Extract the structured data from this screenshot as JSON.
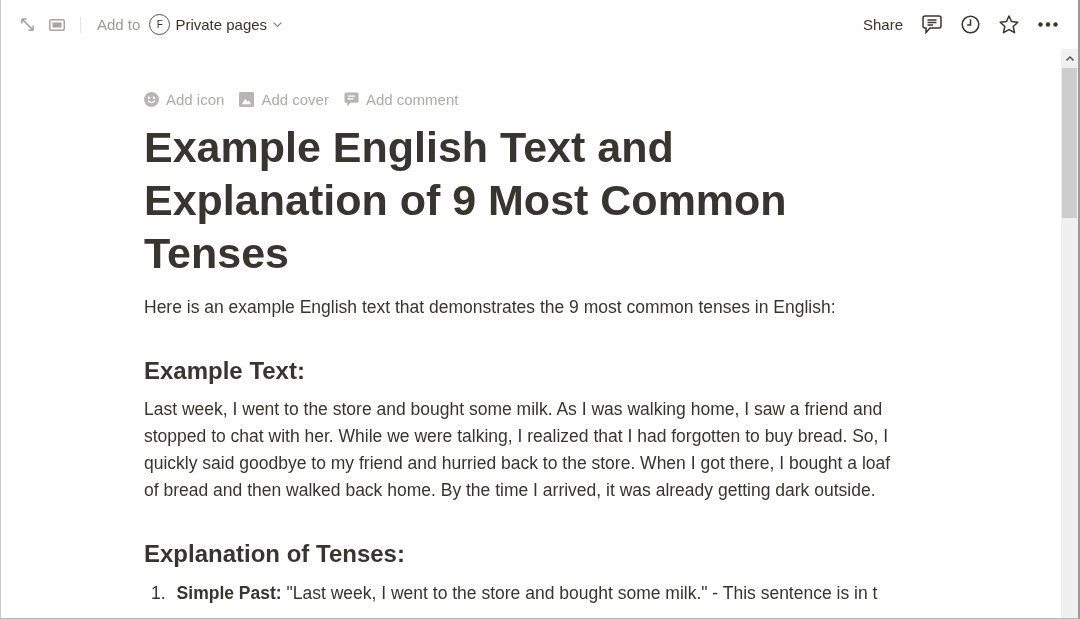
{
  "toolbar": {
    "add_to_label": "Add to",
    "workspace": {
      "initial": "F",
      "name": "Private pages"
    },
    "share_label": "Share"
  },
  "page_actions": [
    {
      "kind": "icon",
      "label": "Add icon"
    },
    {
      "kind": "cover",
      "label": "Add cover"
    },
    {
      "kind": "comment",
      "label": "Add comment"
    }
  ],
  "title": "Example English Text and Explanation of 9 Most Common Tenses",
  "blocks": [
    {
      "kind": "paragraph",
      "text": "Here is an example English text that demonstrates the 9 most common tenses in English:"
    },
    {
      "kind": "heading",
      "text": "Example Text:"
    },
    {
      "kind": "paragraph",
      "text": "Last week, I went to the store and bought some milk. As I was walking home, I saw a friend and stopped to chat with her. While we were talking, I realized that I had forgotten to buy bread. So, I quickly said goodbye to my friend and hurried back to the store. When I got there, I bought a loaf of bread and then walked back home. By the time I arrived, it was already getting dark outside."
    },
    {
      "kind": "heading",
      "text": "Explanation of Tenses:"
    },
    {
      "kind": "numbered_list",
      "items": [
        {
          "number": "1.",
          "text": "**Simple Past:** \"Last week, I went to the store and bought some milk.\" - This sentence is in t"
        }
      ]
    }
  ]
}
